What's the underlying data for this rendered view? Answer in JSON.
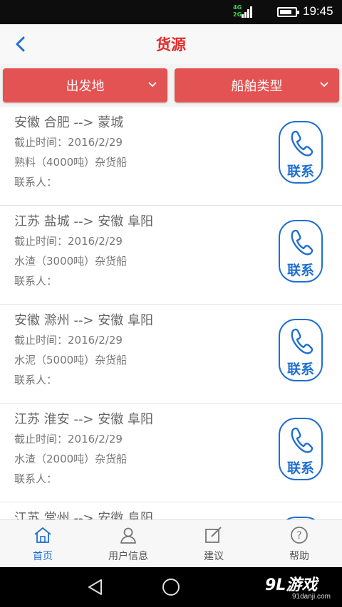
{
  "status_bar": {
    "network_top": "4G",
    "network_bottom": "2G",
    "time": "19:45",
    "battery_level": 0.8
  },
  "header": {
    "title": "货源",
    "back_icon": "chevron-left-icon"
  },
  "filters": [
    {
      "label": "出发地",
      "icon": "chevron-down-icon"
    },
    {
      "label": "船舶类型",
      "icon": "chevron-down-icon"
    }
  ],
  "listings": [
    {
      "route": "安徽 合肥 --> 蒙城",
      "deadline": "截止时间：2016/2/29",
      "cargo": "熟料（4000吨）杂货船",
      "contact": "联系人：",
      "call_label": "联系"
    },
    {
      "route": "江苏 盐城 --> 安徽 阜阳",
      "deadline": "截止时间：2016/2/29",
      "cargo": "水渣（3000吨）杂货船",
      "contact": "联系人：",
      "call_label": "联系"
    },
    {
      "route": "安徽 滁州 --> 安徽 阜阳",
      "deadline": "截止时间：2016/2/29",
      "cargo": "水泥（5000吨）杂货船",
      "contact": "联系人：",
      "call_label": "联系"
    },
    {
      "route": "江苏 淮安 --> 安徽 阜阳",
      "deadline": "截止时间：2016/2/29",
      "cargo": "水渣（2000吨）杂货船",
      "contact": "联系人：",
      "call_label": "联系"
    },
    {
      "route": "江苏 常州 --> 安徽 阜阳",
      "deadline": "",
      "cargo": "",
      "contact": "",
      "call_label": ""
    }
  ],
  "tabs": [
    {
      "label": "首页",
      "icon": "home-icon",
      "active": true
    },
    {
      "label": "用户信息",
      "icon": "user-icon",
      "active": false
    },
    {
      "label": "建议",
      "icon": "edit-icon",
      "active": false
    },
    {
      "label": "帮助",
      "icon": "help-icon",
      "active": false
    }
  ],
  "watermark": {
    "main": "9L游戏",
    "sub": "91danji.com"
  },
  "colors": {
    "accent_red": "#e45353",
    "title_red": "#e32b2b",
    "link_blue": "#1f6fd1"
  }
}
